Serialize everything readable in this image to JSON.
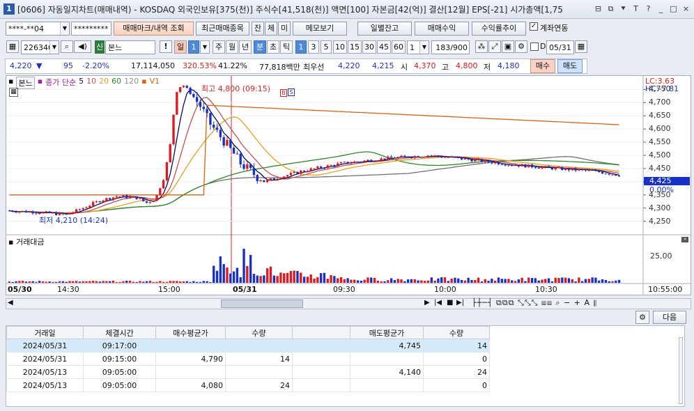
{
  "window": {
    "app_number": "1",
    "title": "[0606] 자동일지차트(매매내역) - KOSDAQ 외국인보유[375(천)] 주식수[41,518(천)] 액면[100] 자본금[42(억)] 결산[12월] EPS[-21] 시가총액[1,75",
    "controls": [
      "⊟",
      "⧉",
      "⯆",
      "T",
      "?",
      "_",
      "□",
      "×"
    ]
  },
  "toolbar1": {
    "account_number": "****-**04",
    "password": "*********",
    "trade_mark_button": "매매마크/내역 조회",
    "recent_trades_button": "최근매매종목",
    "tabs": [
      "잔",
      "체",
      "미"
    ],
    "memo_button": "메모보기",
    "daily_balance_button": "일별잔고",
    "trade_profit_button": "매매수익",
    "return_trend_button": "수익률추이",
    "account_link_label": "계좌연동",
    "account_link_checked": true
  },
  "toolbar2": {
    "stock_code": "226340",
    "stock_name": "본느",
    "stock_prefix": "신",
    "periods": [
      "일",
      "1",
      "주",
      "월",
      "년",
      "분",
      "초",
      "틱"
    ],
    "active_period": "분",
    "intervals": [
      "1",
      "3",
      "5",
      "10",
      "15",
      "30",
      "45",
      "60"
    ],
    "active_interval": "1",
    "multiplier": "1",
    "count": "183",
    "count_total": "/900",
    "date_checkbox_label": "D",
    "date_value": "05/31"
  },
  "quote": {
    "price": "4,220",
    "direction": "▼",
    "change": "95",
    "change_pct": "-2.20%",
    "volume": "17,114,050",
    "volume_ratio": "320.53%",
    "turnover": "41.22%",
    "amount": "77,818백만",
    "best_ask_label": "최우선",
    "best_ask": "4,220",
    "best_bid": "4,215",
    "open_label": "시",
    "open": "4,370",
    "high_label": "고",
    "high": "4,800",
    "low_label": "저",
    "low": "4,180",
    "buy_button": "매수",
    "sell_button": "매도"
  },
  "chart_data": {
    "type": "candlestick",
    "legend": {
      "stock_label": "본느",
      "ma_label": "종가 단순",
      "ma_periods": [
        "5",
        "10",
        "20",
        "60",
        "120"
      ],
      "volume_label": "V1"
    },
    "high_annotation": "최고 4,800 (09:15)",
    "low_annotation": "최저 4,210 (14:24)",
    "y_ticks": [
      4750,
      4700,
      4650,
      4600,
      4550,
      4500,
      4450,
      4400,
      4350,
      4300,
      4250
    ],
    "y_tick_labels": [
      "4,750",
      "4,700",
      "4,650",
      "4,600",
      "4,550",
      "4,500",
      "4,450",
      "4,400",
      "4,350",
      "4,300",
      "4,250"
    ],
    "lc_label": "LC:3.63",
    "hc_label": "HC:-7.81",
    "current_price_label": "4,425",
    "zero_pct_label": "0.00%",
    "volume_panel_title": "거래대금",
    "volume_tick_label": "25,00",
    "x_labels": [
      "05/30",
      "14:30",
      "15:00",
      "05/31",
      "09:30",
      "10:00",
      "10:30",
      "10:55:00"
    ],
    "ylim": [
      4220,
      4780
    ],
    "colors": {
      "up": "#e0191e",
      "down": "#1a31c8",
      "ma5": "#0a0a5a",
      "ma10": "#c75050",
      "ma20": "#e6a020",
      "ma60": "#2a8a2a",
      "ma120": "#707070",
      "v1": "#e06010"
    }
  },
  "timebar": {
    "left_arrow": "◀",
    "right_arrow": "▶",
    "play_controls": [
      "|◀",
      "■",
      "▶|"
    ]
  },
  "bottom": {
    "next_button": "다음",
    "columns": [
      "거래일",
      "체결시간",
      "매수평균가",
      "수량",
      "",
      "매도평균가",
      "수량"
    ],
    "rows": [
      [
        "2024/05/31",
        "09:17:00",
        "",
        "",
        "",
        "4,745",
        "14"
      ],
      [
        "2024/05/31",
        "09:15:00",
        "4,790",
        "14",
        "",
        "",
        "0"
      ],
      [
        "2024/05/13",
        "09:05:00",
        "",
        "",
        "",
        "4,140",
        "24"
      ],
      [
        "2024/05/13",
        "09:05:00",
        "4,080",
        "24",
        "",
        "",
        "0"
      ]
    ]
  }
}
